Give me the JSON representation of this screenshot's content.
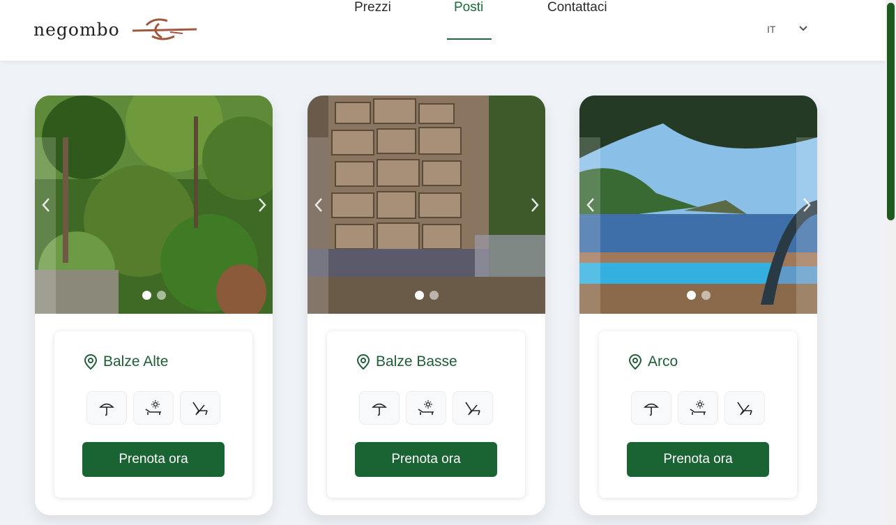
{
  "brand": {
    "name": "negombo"
  },
  "nav": {
    "items": [
      {
        "label": "Prezzi"
      },
      {
        "label": "Posti"
      },
      {
        "label": "Contattaci"
      }
    ],
    "active": "Posti"
  },
  "language": {
    "current": "IT"
  },
  "colors": {
    "brand_green": "#1a6433",
    "logo_brown": "#a0573e",
    "scroll_thumb": "#1e5a1e"
  },
  "cards": [
    {
      "location": "Balze Alte",
      "book_label": "Prenota ora",
      "amenities": [
        "umbrella-icon",
        "sunbed-icon",
        "deckchair-icon"
      ],
      "slides": 2,
      "active_slide": 1
    },
    {
      "location": "Balze Basse",
      "book_label": "Prenota ora",
      "amenities": [
        "umbrella-icon",
        "sunbed-icon",
        "deckchair-icon"
      ],
      "slides": 2,
      "active_slide": 1
    },
    {
      "location": "Arco",
      "book_label": "Prenota ora",
      "amenities": [
        "umbrella-icon",
        "sunbed-icon",
        "deckchair-icon"
      ],
      "slides": 2,
      "active_slide": 1
    }
  ]
}
